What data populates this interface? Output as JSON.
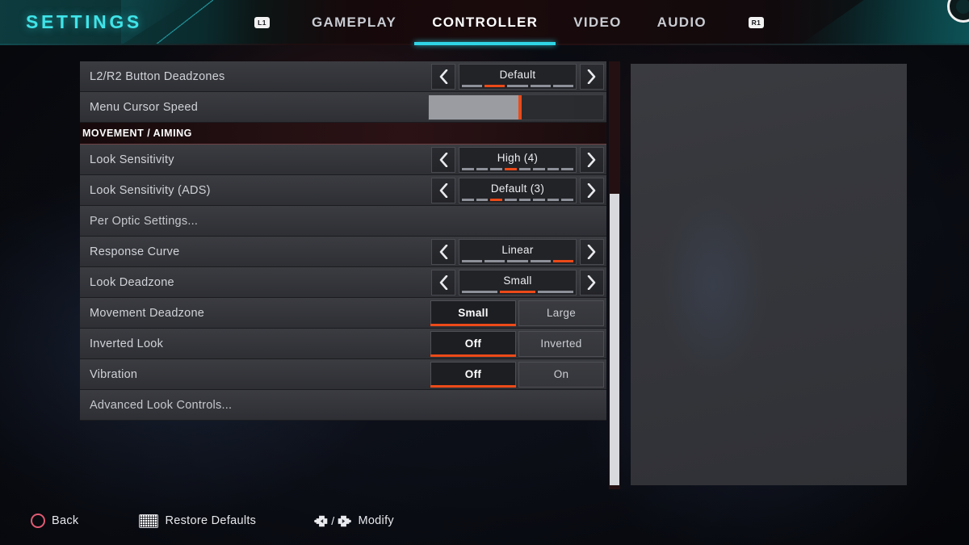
{
  "header": {
    "title": "SETTINGS",
    "left_bumper": "L1",
    "right_bumper": "R1",
    "tabs": [
      {
        "label": "GAMEPLAY",
        "active": false
      },
      {
        "label": "CONTROLLER",
        "active": true
      },
      {
        "label": "VIDEO",
        "active": false
      },
      {
        "label": "AUDIO",
        "active": false
      }
    ],
    "accent_cyan": "#3fe4e8",
    "active_tab_purple": "#8d33c8",
    "active_tab_underline": "#2fd6e6"
  },
  "settings": {
    "rows": [
      {
        "type": "stepper",
        "label": "L2/R2 Button Deadzones",
        "value": "Default",
        "segments": 5,
        "selected_index": 2,
        "left_arrow": "chevron-left",
        "right_arrow": "chevron-right"
      },
      {
        "type": "slider",
        "label": "Menu Cursor Speed",
        "fill_percent": 63
      },
      {
        "type": "section",
        "label": "MOVEMENT / AIMING"
      },
      {
        "type": "stepper",
        "label": "Look Sensitivity",
        "value": "High  (4)",
        "segments": 8,
        "selected_index": 4,
        "left_arrow": "chevron-left",
        "right_arrow": "chevron-right"
      },
      {
        "type": "stepper",
        "label": "Look Sensitivity (ADS)",
        "value": "Default (3)",
        "segments": 8,
        "selected_index": 3,
        "left_arrow": "chevron-left",
        "right_arrow": "chevron-right"
      },
      {
        "type": "nav",
        "label": "Per Optic Settings..."
      },
      {
        "type": "stepper",
        "label": "Response Curve",
        "value": "Linear",
        "segments": 5,
        "selected_index": 5,
        "left_arrow": "chevron-left",
        "right_arrow": "chevron-right"
      },
      {
        "type": "stepper",
        "label": "Look Deadzone",
        "value": "Small",
        "segments": 3,
        "selected_index": 2,
        "left_arrow": "chevron-left",
        "right_arrow": "chevron-right"
      },
      {
        "type": "toggle",
        "label": "Movement Deadzone",
        "options": [
          "Small",
          "Large"
        ],
        "selected": 0
      },
      {
        "type": "toggle",
        "label": "Inverted Look",
        "options": [
          "Off",
          "Inverted"
        ],
        "selected": 0
      },
      {
        "type": "toggle",
        "label": "Vibration",
        "options": [
          "Off",
          "On"
        ],
        "selected": 0
      },
      {
        "type": "nav",
        "label": "Advanced Look Controls..."
      }
    ],
    "accent_orange": "#ec4a19"
  },
  "scrollbar": {
    "thumb_top_percent": 31,
    "thumb_height_percent": 68
  },
  "footer": {
    "back": {
      "label": "Back",
      "icon": "circle-button-icon"
    },
    "restore": {
      "label": "Restore Defaults",
      "icon": "touchpad-icon"
    },
    "modify": {
      "label": "Modify",
      "icon": "dpad-left-right-icon",
      "separator": "/"
    }
  }
}
